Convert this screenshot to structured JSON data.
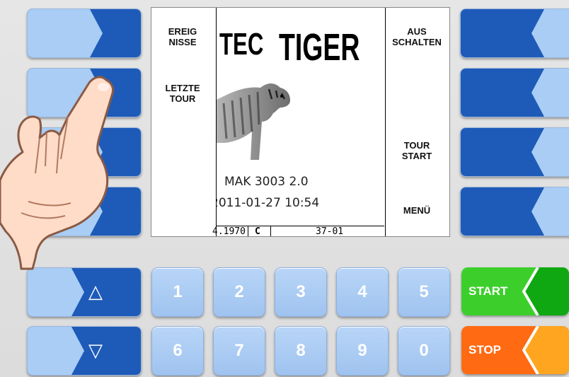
{
  "screen": {
    "left_menu": [
      "EREIG\nNISSE",
      "LETZTE\nTOUR"
    ],
    "right_menu": [
      "AUS\nSCHALTEN",
      "TOUR\nSTART",
      "MENÜ"
    ],
    "logo_left": "TEC",
    "logo_right": "TIGER",
    "version": "MAK 3003 2.0",
    "datetime": "2011-01-27 10:54",
    "status_date": "4.1970",
    "status_mode": "C",
    "status_code": "37-01"
  },
  "keypad": {
    "up_label": "△",
    "down_label": "▽",
    "digits_row1": [
      "1",
      "2",
      "3",
      "4",
      "5"
    ],
    "digits_row2": [
      "6",
      "7",
      "8",
      "9",
      "0"
    ],
    "start_label": "START",
    "stop_label": "STOP"
  },
  "colors": {
    "softkey_dark": "#1e5bb8",
    "softkey_light": "#a9cdf5",
    "start_green": "#3ccf2c",
    "stop_orange": "#ff6a12"
  },
  "icons": {
    "hand": "pointing-hand-icon",
    "tiger": "tiger-image"
  }
}
